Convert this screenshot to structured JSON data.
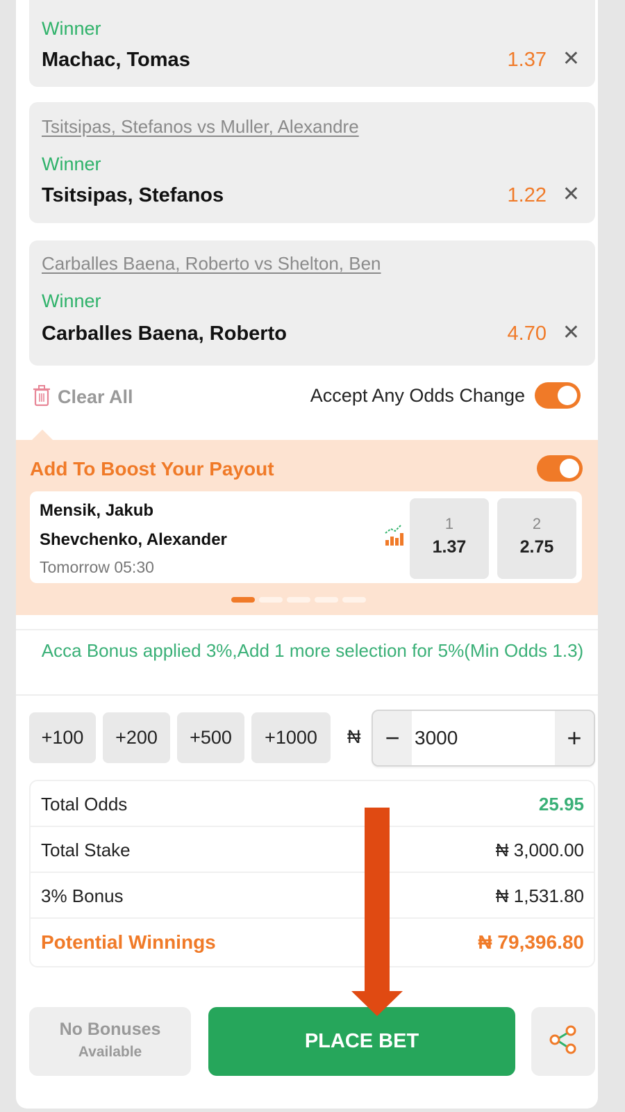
{
  "selections": [
    {
      "event": "",
      "market": "Winner",
      "pick": "Machac, Tomas",
      "odds": "1.37",
      "remove_icon": "close-icon",
      "remove_glyph": "✕"
    },
    {
      "event": "Tsitsipas, Stefanos vs Muller, Alexandre",
      "market": "Winner",
      "pick": "Tsitsipas, Stefanos",
      "odds": "1.22",
      "remove_icon": "close-icon",
      "remove_glyph": "✕"
    },
    {
      "event": "Carballes Baena, Roberto vs Shelton, Ben",
      "market": "Winner",
      "pick": "Carballes Baena, Roberto",
      "odds": "4.70",
      "remove_icon": "close-icon",
      "remove_glyph": "✕"
    }
  ],
  "controls": {
    "clear_all": "Clear All",
    "clear_all_icon": "trash-icon",
    "accept_odds_label": "Accept Any Odds Change",
    "accept_odds_on": true
  },
  "boost": {
    "title": "Add To Boost Your Payout",
    "toggle_on": true,
    "match": {
      "home": "Mensik, Jakub",
      "away": "Shevchenko, Alexander",
      "time": "Tomorrow 05:30",
      "stats_icon": "stats-chart-icon",
      "odds": [
        {
          "label": "1",
          "value": "1.37"
        },
        {
          "label": "2",
          "value": "2.75"
        }
      ]
    },
    "carousel": {
      "count": 5,
      "active_index": 0
    }
  },
  "acca_message": "Acca Bonus applied 3%,Add 1 more selection for 5%(Min Odds 1.3)",
  "stake": {
    "quick_amounts": [
      "+100",
      "+200",
      "+500",
      "+1000"
    ],
    "currency": "₦",
    "minus": "−",
    "plus": "+",
    "value": "3000"
  },
  "summary": {
    "rows": [
      {
        "label": "Total Odds",
        "value": "25.95"
      },
      {
        "label": "Total Stake",
        "value": "₦ 3,000.00"
      },
      {
        "label": "3% Bonus",
        "value": "₦ 1,531.80"
      },
      {
        "label": "Potential Winnings",
        "value": "₦ 79,396.80"
      }
    ]
  },
  "footer": {
    "no_bonus_line1": "No Bonuses",
    "no_bonus_line2": "Available",
    "place_bet": "PLACE BET",
    "share_icon": "share-icon"
  },
  "colors": {
    "accent_orange": "#f07a28",
    "accent_green": "#26a65b",
    "market_green": "#2fb26a",
    "annotation_arrow": "#e04a12",
    "boost_bg": "#fde3d1"
  }
}
